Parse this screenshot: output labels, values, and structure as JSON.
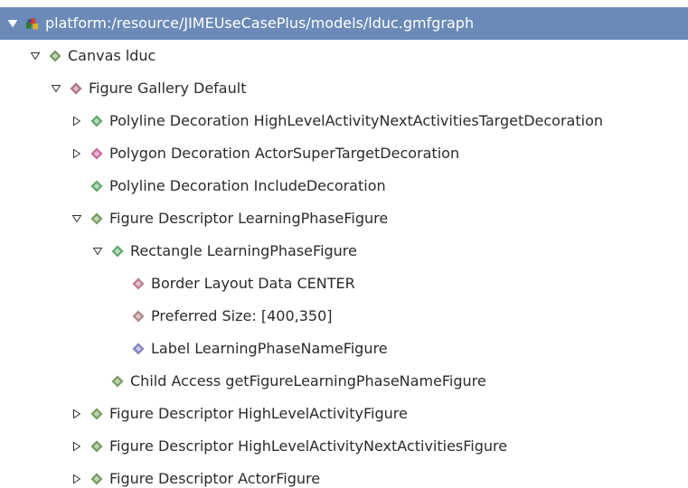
{
  "tree": {
    "root": {
      "label": "platform:/resource/JIMEUseCasePlus/models/lduc.gmfgraph",
      "expanded": true,
      "selected": true,
      "icon": "gmfgraph-resource-icon"
    },
    "nodes": [
      {
        "label": "Canvas lduc",
        "twisty": "expanded",
        "icon": "diamond-icon",
        "icon_color": "#5b8a3c"
      },
      {
        "label": "Figure Gallery Default",
        "twisty": "expanded",
        "icon": "diamond-icon",
        "icon_color": "#a0506e"
      },
      {
        "label": "Polyline Decoration HighLevelActivityNextActivitiesTargetDecoration",
        "twisty": "collapsed",
        "icon": "diamond-icon",
        "icon_color": "#3f9a4f"
      },
      {
        "label": "Polygon Decoration ActorSuperTargetDecoration",
        "twisty": "collapsed",
        "icon": "diamond-icon",
        "icon_color": "#c04a86"
      },
      {
        "label": "Polyline Decoration IncludeDecoration",
        "twisty": "none",
        "icon": "diamond-icon",
        "icon_color": "#3f9a4f"
      },
      {
        "label": "Figure Descriptor LearningPhaseFigure",
        "twisty": "expanded",
        "icon": "diamond-icon",
        "icon_color": "#5b8a3c"
      },
      {
        "label": "Rectangle LearningPhaseFigure",
        "twisty": "expanded",
        "icon": "diamond-icon",
        "icon_color": "#3f9a4f"
      },
      {
        "label": "Border Layout Data CENTER",
        "twisty": "none",
        "icon": "diamond-icon",
        "icon_color": "#b0607e"
      },
      {
        "label": "Preferred Size: [400,350]",
        "twisty": "none",
        "icon": "diamond-icon",
        "icon_color": "#a07070"
      },
      {
        "label": "Label LearningPhaseNameFigure",
        "twisty": "none",
        "icon": "diamond-icon",
        "icon_color": "#6a6ab8"
      },
      {
        "label": "Child Access getFigureLearningPhaseNameFigure",
        "twisty": "none",
        "icon": "diamond-icon",
        "icon_color": "#5b8a3c"
      },
      {
        "label": "Figure Descriptor HighLevelActivityFigure",
        "twisty": "collapsed",
        "icon": "diamond-icon",
        "icon_color": "#5b8a3c"
      },
      {
        "label": "Figure Descriptor HighLevelActivityNextActivitiesFigure",
        "twisty": "collapsed",
        "icon": "diamond-icon",
        "icon_color": "#5b8a3c"
      },
      {
        "label": "Figure Descriptor ActorFigure",
        "twisty": "collapsed",
        "icon": "diamond-icon",
        "icon_color": "#5b8a3c"
      }
    ]
  }
}
